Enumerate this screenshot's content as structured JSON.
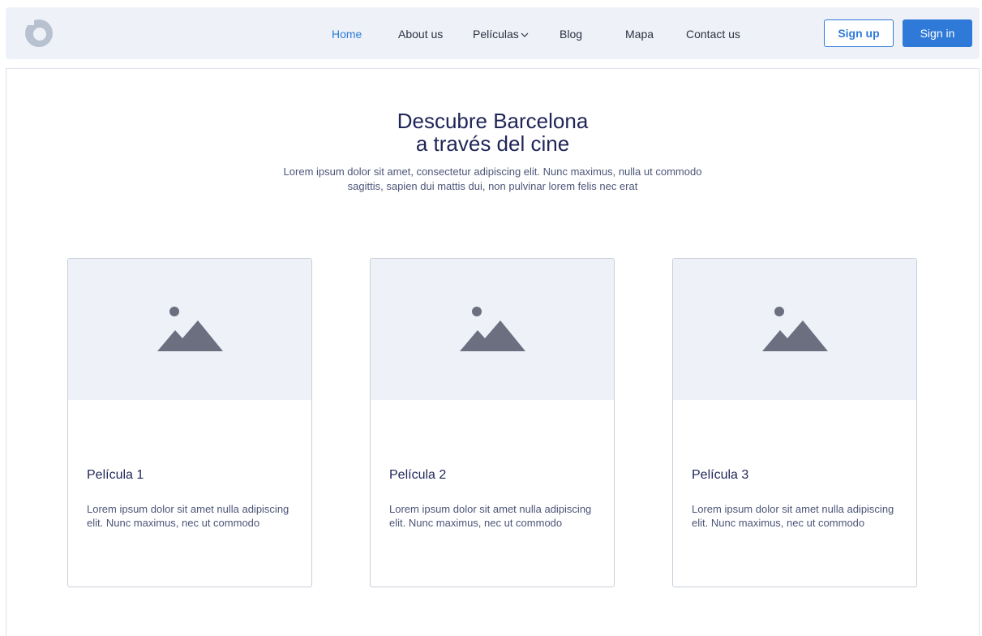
{
  "navbar": {
    "links": [
      {
        "label": "Home",
        "active": true
      },
      {
        "label": "About us",
        "active": false
      },
      {
        "label": "Películas",
        "active": false,
        "dropdown": true
      },
      {
        "label": "Blog",
        "active": false
      },
      {
        "label": "Mapa",
        "active": false
      },
      {
        "label": "Contact us",
        "active": false
      }
    ],
    "signup_label": "Sign up",
    "signin_label": "Sign in"
  },
  "hero": {
    "title_line1": "Descubre Barcelona",
    "title_line2": "a través del cine",
    "subtitle": "Lorem ipsum dolor sit amet, consectetur adipiscing elit. Nunc maximus, nulla ut commodo sagittis, sapien dui mattis dui, non pulvinar lorem felis nec erat"
  },
  "cards": [
    {
      "title": "Película 1",
      "text": "Lorem ipsum dolor sit amet nulla adipiscing elit. Nunc maximus, nec ut commodo"
    },
    {
      "title": "Película 2",
      "text": "Lorem ipsum dolor sit amet nulla adipiscing elit. Nunc maximus, nec ut commodo"
    },
    {
      "title": "Película 3",
      "text": "Lorem ipsum dolor sit amet nulla adipiscing elit. Nunc maximus, nec ut commodo"
    }
  ],
  "colors": {
    "accent": "#2f7ad8",
    "nav_bg": "#eef2f8",
    "heading": "#1f2557",
    "body_text": "#4c5578",
    "placeholder_icon": "#6b6f80",
    "logo": "#b8c1cf"
  },
  "icons": {
    "logo": "circular-logo-icon",
    "dropdown": "chevron-down-icon",
    "card_placeholder": "image-placeholder-icon"
  }
}
